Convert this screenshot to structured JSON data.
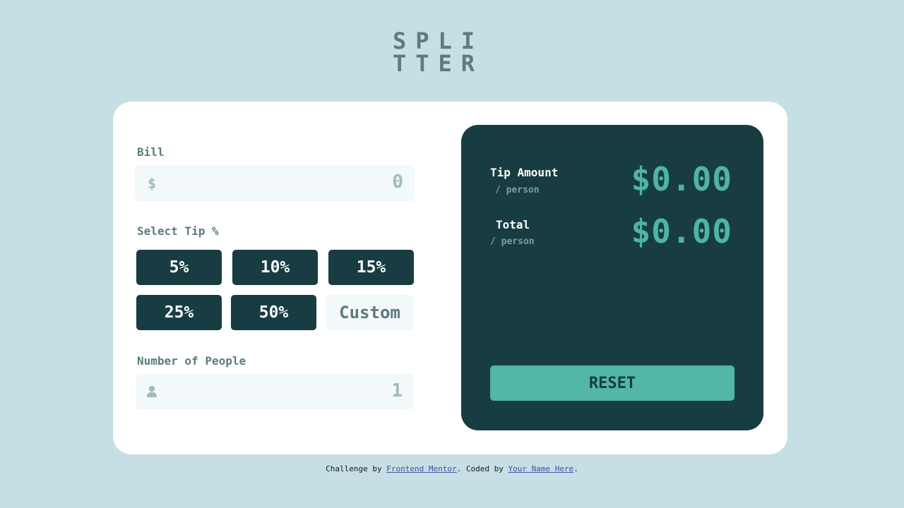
{
  "logo": {
    "line1": "SPLI",
    "line2": "TTER"
  },
  "bill": {
    "label": "Bill",
    "prefix": "$",
    "placeholder": "0"
  },
  "tip": {
    "label": "Select Tip %",
    "options": [
      "5%",
      "10%",
      "15%",
      "25%",
      "50%"
    ],
    "custom_placeholder": "Custom"
  },
  "people": {
    "label": "Number of People",
    "placeholder": "1"
  },
  "results": {
    "tip_amount": {
      "title": "Tip Amount",
      "sub": "/ person",
      "value": "$0.00"
    },
    "total": {
      "title": "Total",
      "sub": "/ person",
      "value": "$0.00"
    },
    "reset_label": "RESET"
  },
  "attribution": {
    "prefix": "Challenge by ",
    "link1": "Frontend Mentor",
    "middle": ". Coded by ",
    "link2": "Your Name Here",
    "suffix": "."
  },
  "colors": {
    "background": "#c5dfe4",
    "panel": "#173d42",
    "accent": "#52b6a8",
    "muted": "#5e7a7d"
  },
  "icons": {
    "bill_prefix": "dollar-icon",
    "people_prefix": "person-icon"
  }
}
